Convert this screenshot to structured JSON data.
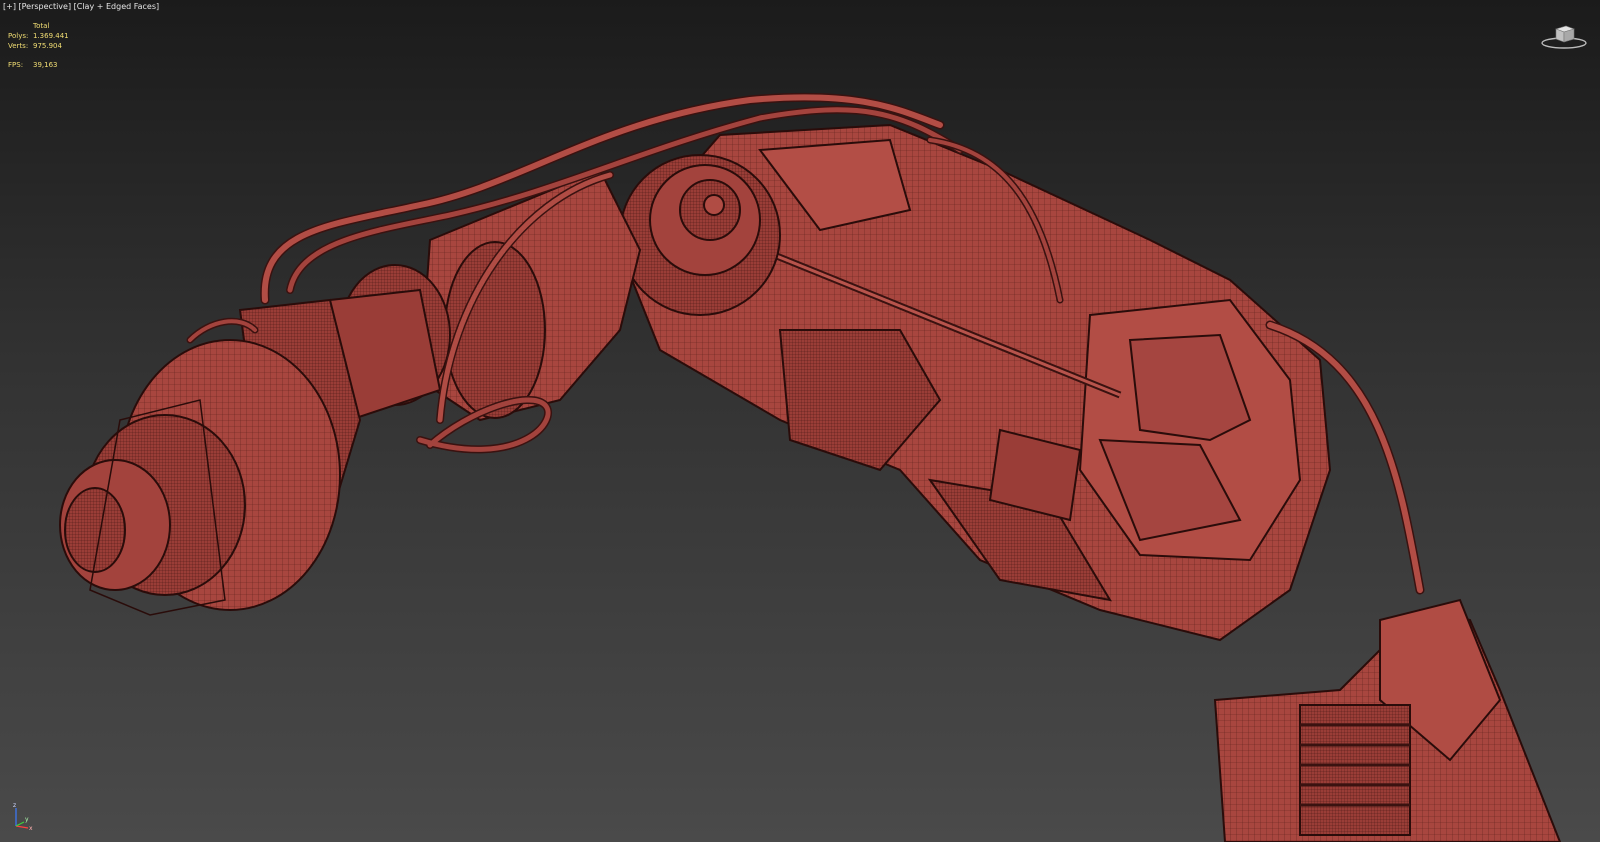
{
  "viewport": {
    "label_plus": "[+]",
    "label_view": "[Perspective]",
    "label_shading": "[Clay + Edged Faces]"
  },
  "stats": {
    "header": "Total",
    "polys_label": "Polys:",
    "polys_value": "1.369.441",
    "verts_label": "Verts:",
    "verts_value": "975.904",
    "fps_label": "FPS:",
    "fps_value": "39,163"
  },
  "axis_tripod": {
    "z": "z",
    "x": "x",
    "y": "y"
  },
  "colors": {
    "viewport_top": "#1b1b1b",
    "viewport_bottom": "#4a4a4a",
    "stats_text": "#f3df74",
    "label_text": "#e6e6e6",
    "model_clay": "#a8463f",
    "wire": "#3a1210"
  },
  "icons": {
    "viewcube": "viewcube-icon",
    "axis": "axis-tripod-icon"
  }
}
